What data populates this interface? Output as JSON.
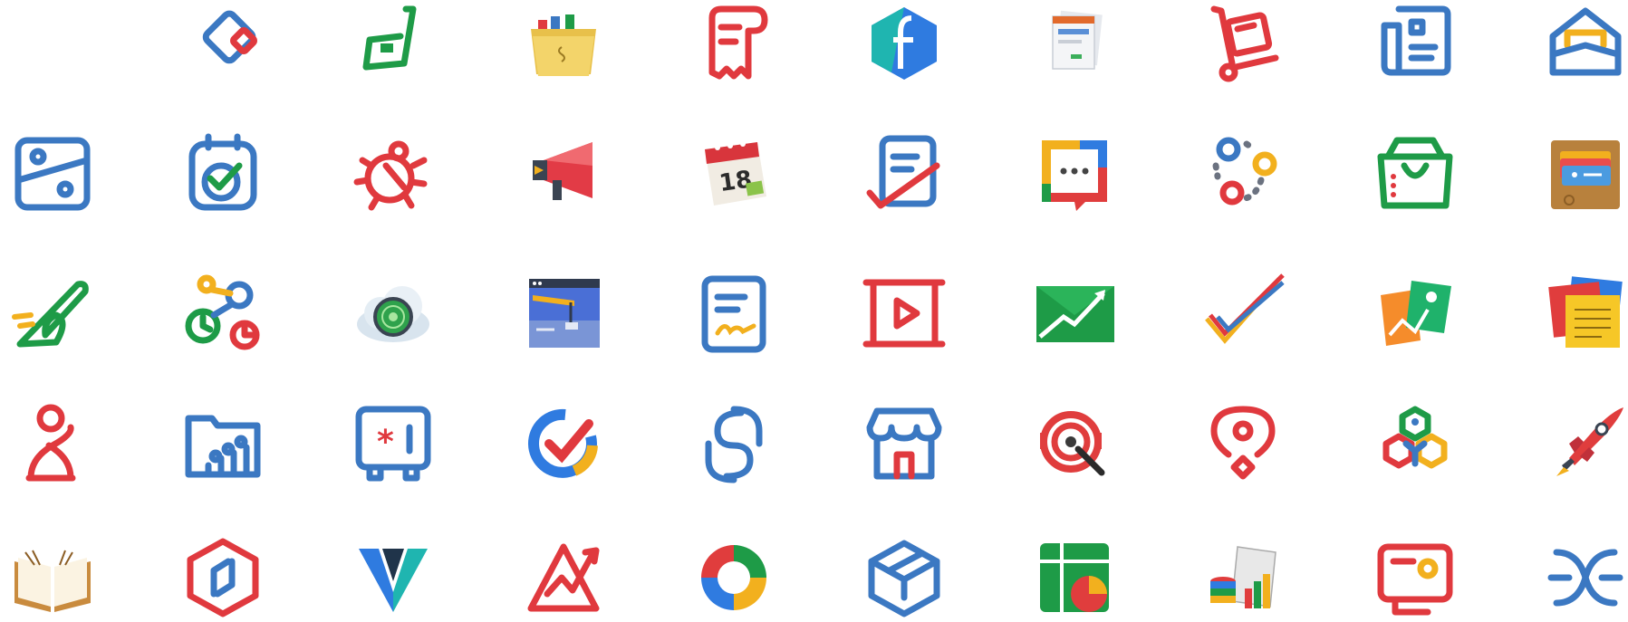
{
  "palette": {
    "blue": "#3B78C2",
    "red": "#E0393E",
    "green": "#1E9B47",
    "yellow": "#F2B01E",
    "teal": "#1FB5B0",
    "gray": "#6B7280"
  },
  "icon_rows": [
    [
      "blank-slot",
      "zoho-inventory-icon",
      "green-d-letter-icon",
      "yellow-file-folders-icon",
      "receipt-scroll-icon",
      "blue-hexagon-f-icon",
      "stacked-web-pages-icon",
      "hand-truck-box-icon",
      "newspaper-document-icon",
      "open-envelope-icon"
    ],
    [
      "z-slider-icon",
      "calendar-check-icon",
      "bug-icon",
      "megaphone-icon",
      "tear-off-calendar-icon",
      "document-signature-check-icon",
      "chat-bubble-dots-icon",
      "three-circles-network-icon",
      "shopping-bag-icon",
      "wallet-cards-icon"
    ],
    [
      "green-sign-stroke-icon",
      "timer-workflow-icon",
      "cloud-radar-icon",
      "browser-window-banner-icon",
      "document-signature-icon",
      "video-play-frame-icon",
      "green-trend-arrow-icon",
      "double-check-icon",
      "photo-cards-icon",
      "sticky-notes-icon"
    ],
    [
      "hourglass-figure-icon",
      "folder-people-icon",
      "password-vault-icon",
      "circular-check-icon",
      "s-curve-icon",
      "storefront-icon",
      "target-headset-icon",
      "location-pin-icon",
      "hexagon-network-icon",
      "rocket-icon"
    ],
    [
      "open-book-icon",
      "hexagon-link-icon",
      "w-letter-mark-icon",
      "triangle-growth-arrow-icon",
      "colorful-ring-icon",
      "isometric-box-icon",
      "spreadsheet-pie-icon",
      "database-report-icon",
      "id-card-icon",
      "x-knot-icon"
    ]
  ]
}
